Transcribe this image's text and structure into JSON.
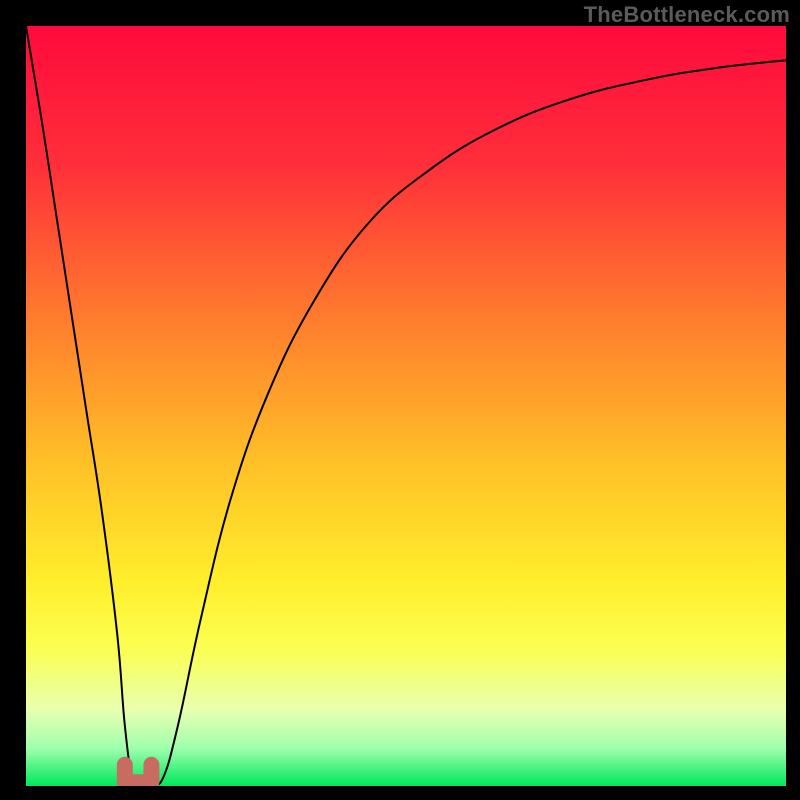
{
  "watermark": "TheBottleneck.com",
  "colors": {
    "frame": "#000000",
    "gradient_stops": [
      {
        "offset": 0.0,
        "color": "#ff0a3c"
      },
      {
        "offset": 0.18,
        "color": "#ff2e3a"
      },
      {
        "offset": 0.38,
        "color": "#ff7a2e"
      },
      {
        "offset": 0.58,
        "color": "#ffc227"
      },
      {
        "offset": 0.73,
        "color": "#ffee2b"
      },
      {
        "offset": 0.82,
        "color": "#fbff52"
      },
      {
        "offset": 0.9,
        "color": "#e8ffb0"
      },
      {
        "offset": 0.95,
        "color": "#9fffad"
      },
      {
        "offset": 1.0,
        "color": "#00e85c"
      }
    ],
    "curve": "#000000",
    "marker_fill": "#c86b60",
    "marker_stroke": "#c86b60"
  },
  "chart_data": {
    "type": "line",
    "title": "",
    "xlabel": "",
    "ylabel": "",
    "xlim": [
      0,
      100
    ],
    "ylim": [
      0,
      100
    ],
    "grid": false,
    "legend": false,
    "series": [
      {
        "name": "bottleneck-curve",
        "x": [
          0,
          2,
          4,
          6,
          8,
          10,
          12,
          13,
          14,
          15,
          16.5,
          18,
          20,
          23,
          27,
          32,
          38,
          45,
          53,
          62,
          72,
          82,
          91,
          100
        ],
        "y": [
          100,
          88,
          75,
          62,
          49,
          36,
          20,
          8,
          1,
          0.5,
          0.5,
          1,
          8,
          22,
          38,
          52,
          64,
          74,
          81,
          86.5,
          90.5,
          93,
          94.5,
          95.5
        ]
      }
    ],
    "marker": {
      "name": "optimal-range",
      "x_range": [
        13.0,
        16.5
      ],
      "y": 0.5
    }
  }
}
